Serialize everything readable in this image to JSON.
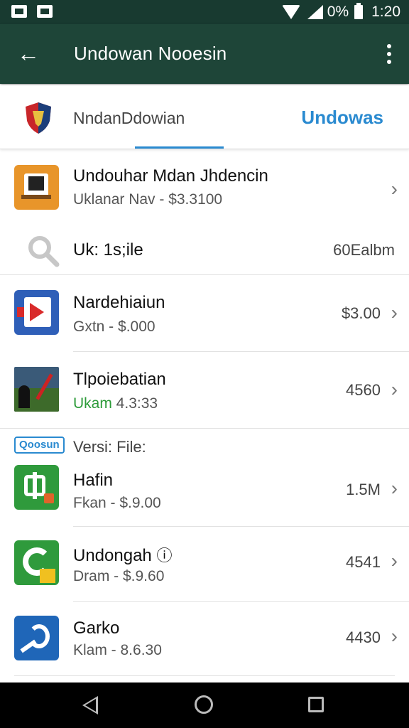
{
  "status_bar": {
    "battery": "0%",
    "time": "1:20"
  },
  "app_bar": {
    "title": "Undowan Nooesin"
  },
  "tabs": {
    "left_label": "NndanDdowian",
    "right_label": "Undowas"
  },
  "featured": {
    "title": "Undouhar Mdan Jhdencin",
    "subtitle": "Uklanar Nav - $3.3100"
  },
  "search_row": {
    "label": "Uk: 1s;ile",
    "value": "60Ealbm"
  },
  "list_items": [
    {
      "title": "Nardehiaiun",
      "subtitle": "Gxtn - $.000",
      "value": "$3.00",
      "icon": "video-app-icon"
    },
    {
      "title": "Tlpoiebatian",
      "subtitle_prefix": "Ukam",
      "subtitle_rest": " 4.3:33",
      "value": "4560",
      "icon": "landscape-photo-icon"
    }
  ],
  "section": {
    "badge": "Qoosun",
    "label": "Versi: File:"
  },
  "version_items": [
    {
      "title": "Hafin",
      "subtitle": "Fkan - $.9.00",
      "value": "1.5M",
      "icon": "green-app-icon"
    },
    {
      "title": "Undongah",
      "info_icon": "ⓘ",
      "subtitle": "Dram - $.9.60",
      "value": "4541",
      "icon": "green-c-app-icon"
    },
    {
      "title": "Garko",
      "subtitle": "Klam - 8.6.30",
      "value": "4430",
      "icon": "blue-app-icon"
    }
  ]
}
